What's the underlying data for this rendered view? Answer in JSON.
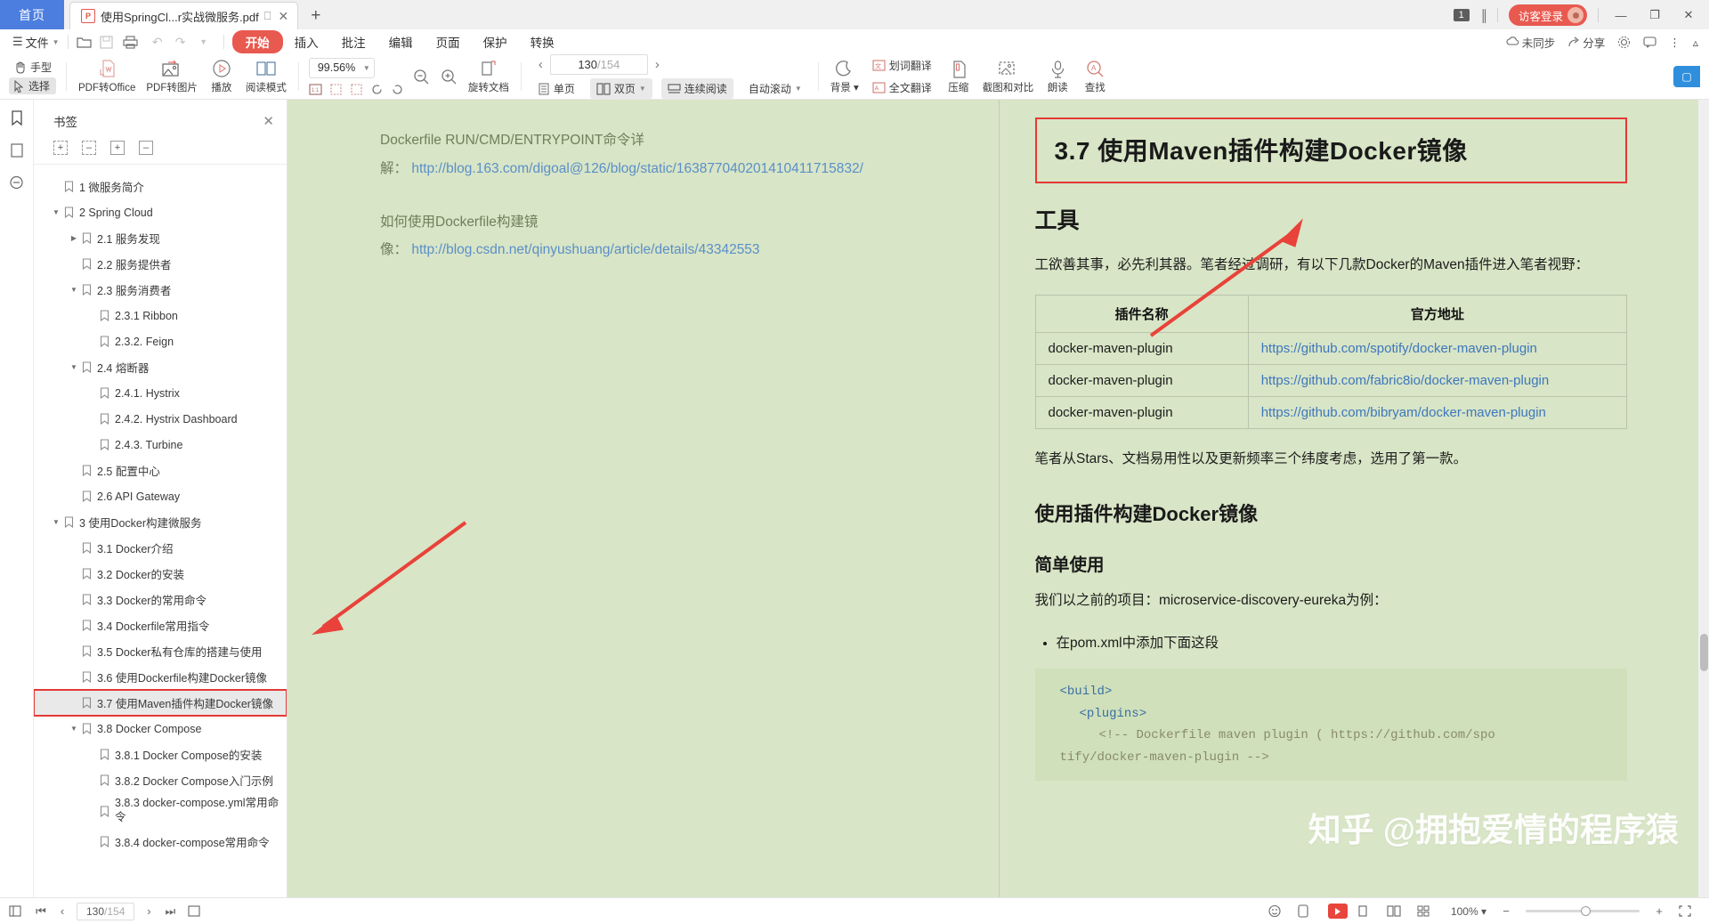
{
  "window": {
    "home_tab": "首页",
    "doc_tab_title": "使用SpringCl...r实战微服务.pdf",
    "doc_tab_badge": "P",
    "new_tab": "+",
    "count_badge": "1",
    "login_label": "访客登录",
    "minimize": "—",
    "maximize": "❐",
    "close": "✕"
  },
  "menu": {
    "file": "文件",
    "tabs": [
      "开始",
      "插入",
      "批注",
      "编辑",
      "页面",
      "保护",
      "转换"
    ],
    "active_tab": "开始",
    "right": {
      "sync": "未同步",
      "share": "分享",
      "settings_icon": "gear-icon",
      "comment_icon": "comment-icon",
      "more_icon": "more-icon",
      "collapse_icon": "chevron-up-icon"
    }
  },
  "toolbar": {
    "hand": "手型",
    "select": "选择",
    "pdf_to_office": "PDF转Office",
    "pdf_to_image": "PDF转图片",
    "play": "播放",
    "reading_mode": "阅读模式",
    "zoom_value": "99.56%",
    "rotate_doc": "旋转文档",
    "single_page": "单页",
    "double_page": "双页",
    "continuous_read": "连续阅读",
    "auto_scroll": "自动滚动",
    "background": "背景",
    "word_translate": "划词翻译",
    "full_translate": "全文翻译",
    "compress": "压缩",
    "screenshot_compare": "截图和对比",
    "read_aloud": "朗读",
    "find": "查找",
    "page_current": "130",
    "page_total": "/154"
  },
  "sidebar": {
    "title": "书签",
    "close": "✕",
    "tools": [
      "expand-all",
      "collapse-all",
      "add-bookmark",
      "delete-bookmark"
    ],
    "items": [
      {
        "label": "1 微服务简介",
        "indent": 0,
        "arrow": "none"
      },
      {
        "label": "2 Spring Cloud",
        "indent": 0,
        "arrow": "down"
      },
      {
        "label": "2.1 服务发现",
        "indent": 1,
        "arrow": "right"
      },
      {
        "label": "2.2 服务提供者",
        "indent": 1,
        "arrow": "none"
      },
      {
        "label": "2.3 服务消费者",
        "indent": 1,
        "arrow": "down"
      },
      {
        "label": "2.3.1 Ribbon",
        "indent": 2,
        "arrow": "none"
      },
      {
        "label": "2.3.2. Feign",
        "indent": 2,
        "arrow": "none"
      },
      {
        "label": "2.4 熔断器",
        "indent": 1,
        "arrow": "down"
      },
      {
        "label": "2.4.1. Hystrix",
        "indent": 2,
        "arrow": "none"
      },
      {
        "label": "2.4.2. Hystrix Dashboard",
        "indent": 2,
        "arrow": "none"
      },
      {
        "label": "2.4.3. Turbine",
        "indent": 2,
        "arrow": "none"
      },
      {
        "label": "2.5 配置中心",
        "indent": 1,
        "arrow": "none"
      },
      {
        "label": "2.6 API Gateway",
        "indent": 1,
        "arrow": "none"
      },
      {
        "label": "3 使用Docker构建微服务",
        "indent": 0,
        "arrow": "down"
      },
      {
        "label": "3.1 Docker介绍",
        "indent": 1,
        "arrow": "none"
      },
      {
        "label": "3.2 Docker的安装",
        "indent": 1,
        "arrow": "none"
      },
      {
        "label": "3.3 Docker的常用命令",
        "indent": 1,
        "arrow": "none"
      },
      {
        "label": "3.4 Dockerfile常用指令",
        "indent": 1,
        "arrow": "none"
      },
      {
        "label": "3.5 Docker私有仓库的搭建与使用",
        "indent": 1,
        "arrow": "none"
      },
      {
        "label": "3.6 使用Dockerfile构建Docker镜像",
        "indent": 1,
        "arrow": "none"
      },
      {
        "label": "3.7 使用Maven插件构建Docker镜像",
        "indent": 1,
        "arrow": "none",
        "selected": true,
        "highlighted": true
      },
      {
        "label": "3.8 Docker Compose",
        "indent": 1,
        "arrow": "down"
      },
      {
        "label": "3.8.1 Docker Compose的安装",
        "indent": 2,
        "arrow": "none"
      },
      {
        "label": "3.8.2 Docker Compose入门示例",
        "indent": 2,
        "arrow": "none"
      },
      {
        "label": "3.8.3 docker-compose.yml常用命令",
        "indent": 2,
        "arrow": "none",
        "two_line": true
      },
      {
        "label": "3.8.4 docker-compose常用命令",
        "indent": 2,
        "arrow": "none"
      }
    ]
  },
  "left_page": {
    "line1": "Dockerfile RUN/CMD/ENTRYPOINT命令详",
    "line2_prefix": "解：",
    "line2_link": "http://blog.163.com/digoal@126/blog/static/163877040201410411715832/",
    "line3": "如何使用Dockerfile构建镜",
    "line4_prefix": "像：",
    "line4_link": "http://blog.csdn.net/qinyushuang/article/details/43342553"
  },
  "right_page": {
    "heading_h1": "3.7 使用Maven插件构建Docker镜像",
    "heading_tools": "工具",
    "para1": "工欲善其事，必先利其器。笔者经过调研，有以下几款Docker的Maven插件进入笔者视野：",
    "table": {
      "headers": [
        "插件名称",
        "官方地址"
      ],
      "rows": [
        {
          "name": "docker-maven-plugin",
          "url": "https://github.com/spotify/docker-maven-plugin"
        },
        {
          "name": "docker-maven-plugin",
          "url": "https://github.com/fabric8io/docker-maven-plugin"
        },
        {
          "name": "docker-maven-plugin",
          "url": "https://github.com/bibryam/docker-maven-plugin"
        }
      ]
    },
    "para2": "笔者从Stars、文档易用性以及更新频率三个纬度考虑，选用了第一款。",
    "heading_build": "使用插件构建Docker镜像",
    "heading_simple": "简单使用",
    "para3": "我们以之前的项目：microservice-discovery-eureka为例：",
    "bullet1": "在pom.xml中添加下面这段",
    "code_line1": "<build>",
    "code_line2": "<plugins>",
    "code_line3": "<!-- Dockerfile maven plugin ( https://github.com/spo",
    "code_line4": "tify/docker-maven-plugin -->",
    "watermark": "知乎 @拥抱爱情的程序猿"
  },
  "status": {
    "first_page": "⏮",
    "prev_page": "‹",
    "page_current": "130",
    "page_total": "/154",
    "next_page": "›",
    "last_page": "⏭",
    "zoom_label": "100%",
    "zoom_minus": "−",
    "zoom_plus": "+",
    "fit_icon": "fit-page-icon"
  },
  "colors": {
    "accent_red": "#e8594f",
    "highlight_red": "#e53935",
    "page_bg": "#d8e5c6",
    "link_blue": "#3d77bd",
    "home_tab_blue": "#4c7ee0"
  }
}
